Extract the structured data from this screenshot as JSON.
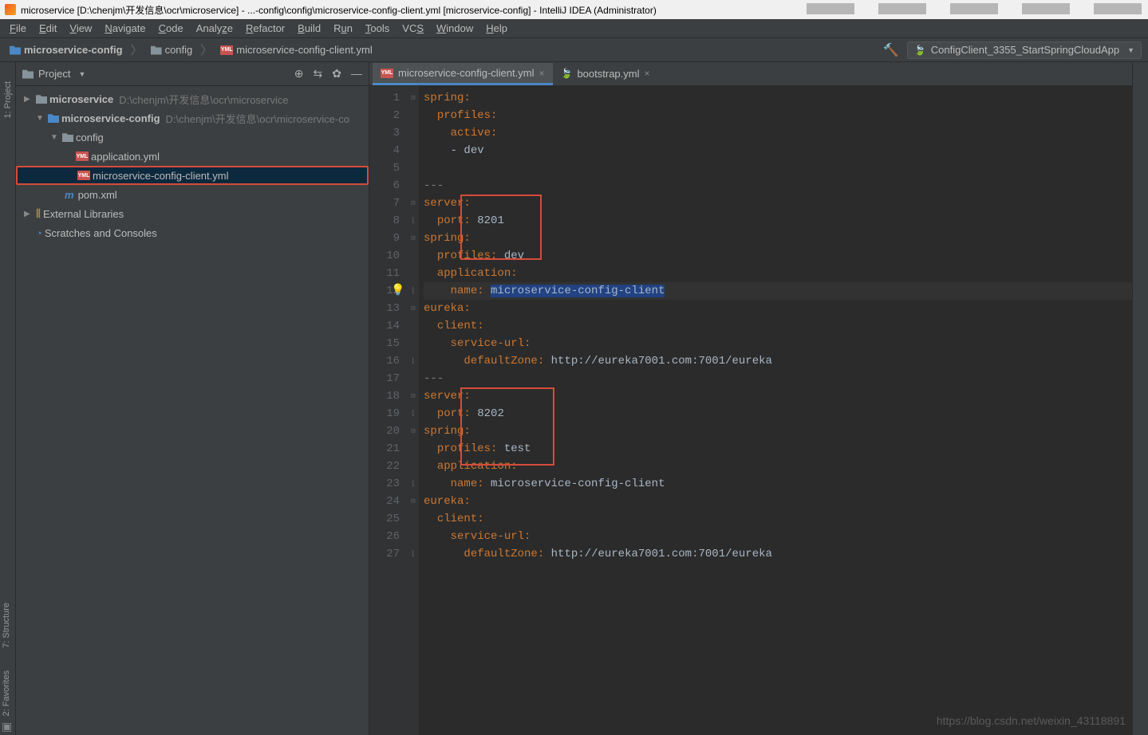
{
  "window": {
    "title": "microservice [D:\\chenjm\\开发信息\\ocr\\microservice] - ...-config\\config\\microservice-config-client.yml [microservice-config] - IntelliJ IDEA (Administrator)"
  },
  "menus": [
    "File",
    "Edit",
    "View",
    "Navigate",
    "Code",
    "Analyze",
    "Refactor",
    "Build",
    "Run",
    "Tools",
    "VCS",
    "Window",
    "Help"
  ],
  "breadcrumbs": {
    "b1": "microservice-config",
    "b2": "config",
    "b3": "microservice-config-client.yml"
  },
  "run_config": "ConfigClient_3355_StartSpringCloudApp",
  "panel": {
    "title": "Project"
  },
  "tree": {
    "root": "microservice",
    "root_path": "D:\\chenjm\\开发信息\\ocr\\microservice",
    "cfg": "microservice-config",
    "cfg_path": "D:\\chenjm\\开发信息\\ocr\\microservice-co",
    "config_folder": "config",
    "app_yml": "application.yml",
    "client_yml": "microservice-config-client.yml",
    "pom": "pom.xml",
    "ext": "External Libraries",
    "scr": "Scratches and Consoles"
  },
  "tabs": {
    "t1": "microservice-config-client.yml",
    "t2": "bootstrap.yml"
  },
  "code": {
    "l1": {
      "a": "spring",
      "b": ":"
    },
    "l2": {
      "a": "profiles",
      "b": ":"
    },
    "l3": {
      "a": "active",
      "b": ":"
    },
    "l4": {
      "a": "- dev"
    },
    "l5": "",
    "l6": {
      "a": "---"
    },
    "l7": {
      "a": "server",
      "b": ":"
    },
    "l8": {
      "a": "port",
      "b": ": ",
      "c": "8201"
    },
    "l9": {
      "a": "spring",
      "b": ":"
    },
    "l10": {
      "a": "profiles",
      "b": ": ",
      "c": "dev"
    },
    "l11": {
      "a": "application",
      "b": ":"
    },
    "l12": {
      "a": "name",
      "b": ": ",
      "c": "microservice-config-client"
    },
    "l13": {
      "a": "eureka",
      "b": ":"
    },
    "l14": {
      "a": "client",
      "b": ":"
    },
    "l15": {
      "a": "service-url",
      "b": ":"
    },
    "l16": {
      "a": "defaultZone",
      "b": ": ",
      "c": "http://eureka7001.com:7001/eureka"
    },
    "l17": {
      "a": "---"
    },
    "l18": {
      "a": "server",
      "b": ":"
    },
    "l19": {
      "a": "port",
      "b": ": ",
      "c": "8202"
    },
    "l20": {
      "a": "spring",
      "b": ":"
    },
    "l21": {
      "a": "profiles",
      "b": ": ",
      "c": "test"
    },
    "l22": {
      "a": "application",
      "b": ":"
    },
    "l23": {
      "a": "name",
      "b": ": ",
      "c": "microservice-config-client"
    },
    "l24": {
      "a": "eureka",
      "b": ":"
    },
    "l25": {
      "a": "client",
      "b": ":"
    },
    "l26": {
      "a": "service-url",
      "b": ":"
    },
    "l27": {
      "a": "defaultZone",
      "b": ": ",
      "c": "http://eureka7001.com:7001/eureka"
    }
  },
  "watermark": "https://blog.csdn.net/weixin_43118891",
  "side": {
    "project": "1: Project",
    "structure": "7: Structure",
    "favorites": "2: Favorites"
  }
}
